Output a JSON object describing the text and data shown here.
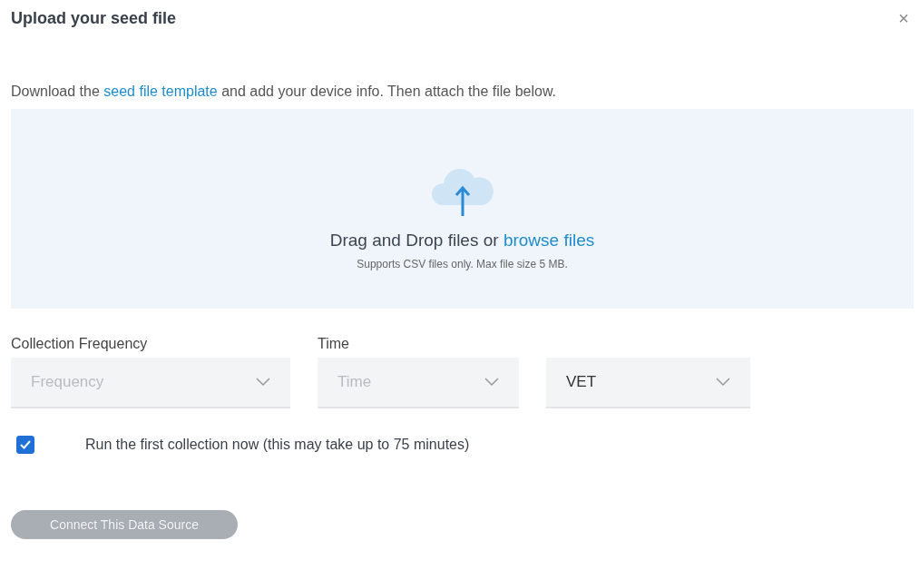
{
  "dialog": {
    "title": "Upload your seed file",
    "close": "×"
  },
  "intro": {
    "before": "Download the ",
    "link": "seed file template",
    "after": " and add your device info. Then attach the file below."
  },
  "dropzone": {
    "text": "Drag and Drop files or ",
    "link": "browse files",
    "hint": "Supports CSV files only. Max file size 5 MB."
  },
  "selects": [
    {
      "label": "Collection Frequency",
      "placeholder": "Frequency"
    },
    {
      "label": "Time",
      "placeholder": "Time"
    },
    {
      "value": "VET"
    }
  ],
  "checkbox": {
    "label": "Run the first collection now (this may take up to 75 minutes)",
    "checked": true
  },
  "submit": {
    "label": "Connect This Data Source",
    "disabled": true
  }
}
